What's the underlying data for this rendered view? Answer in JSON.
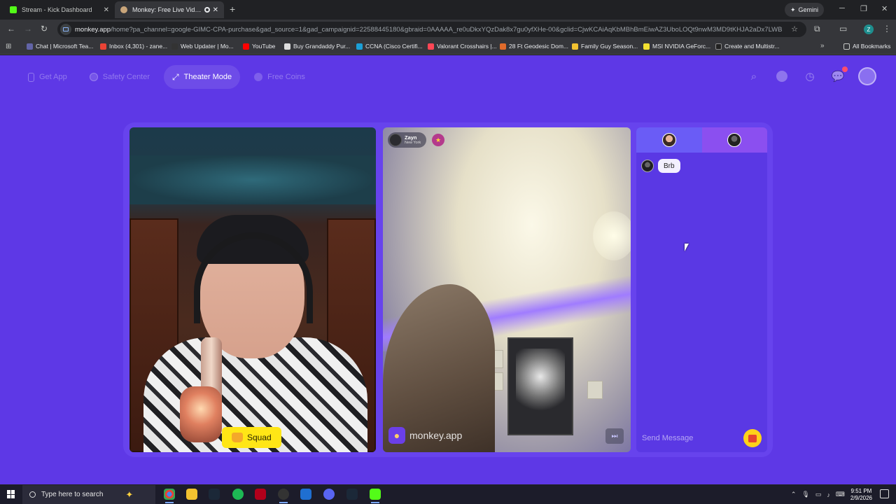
{
  "browser": {
    "tabs": [
      {
        "title": "Stream - Kick Dashboard",
        "favicon_color": "#53fc18"
      },
      {
        "title": "Monkey: Free Live Video Ch",
        "favicon_color": "#c9a57a"
      }
    ],
    "gemini_label": "Gemini",
    "url_domain": "monkey.app",
    "url_path": "/home?pa_channel=google-GIMC-CPA-purchase&gad_source=1&gad_campaignid=22588445180&gbraid=0AAAAA_re0uDkxYQzDak8x7gu0yfXHe-00&gclid=CjwKCAiAqKbMBhBmEiwAZ3UboLOQt9nwM3MD9tKHJA2aDx7LWBnmmtfL...",
    "profile_letter": "Z",
    "bookmarks": [
      {
        "label": "Chat | Microsoft Tea...",
        "color": "#6264a7"
      },
      {
        "label": "Inbox (4,301) - zane...",
        "color": "#ea4335"
      },
      {
        "label": "Web Updater | Mo...",
        "color": "#333333"
      },
      {
        "label": "YouTube",
        "color": "#ff0000"
      },
      {
        "label": "Buy Grandaddy Pur...",
        "color": "#dddddd"
      },
      {
        "label": "CCNA (Cisco Certifi...",
        "color": "#1ba0d7"
      },
      {
        "label": "Valorant Crosshairs |...",
        "color": "#ff4655"
      },
      {
        "label": "28 Ft Geodesic Dom...",
        "color": "#e06b2b"
      },
      {
        "label": "Family Guy Season...",
        "color": "#f2c230"
      },
      {
        "label": "MSI NVIDIA GeForc...",
        "color": "#f2e030"
      },
      {
        "label": "Create and Multistr...",
        "color": "#222222"
      }
    ],
    "all_bookmarks_label": "All Bookmarks"
  },
  "page": {
    "nav": [
      {
        "label": "Get App",
        "icon": "phone-icon"
      },
      {
        "label": "Safety Center",
        "icon": "shield-icon"
      },
      {
        "label": "Theater Mode",
        "icon": "expand-icon"
      },
      {
        "label": "Free Coins",
        "icon": "coin-icon"
      }
    ],
    "active_nav": "Theater Mode",
    "squad_label": "Squad",
    "partner": {
      "name": "Zayn",
      "location": "New York"
    },
    "watermark": "monkey.app",
    "chat": {
      "messages": [
        {
          "text": "Brb"
        }
      ],
      "placeholder": "Send Message"
    },
    "colors": {
      "page_bg": "#5e38e6",
      "squad": "#ffe616",
      "gift": "#ffd21a"
    }
  },
  "taskbar": {
    "search_placeholder": "Type here to search",
    "time": "9:51 PM",
    "date": "2/9/2026"
  }
}
